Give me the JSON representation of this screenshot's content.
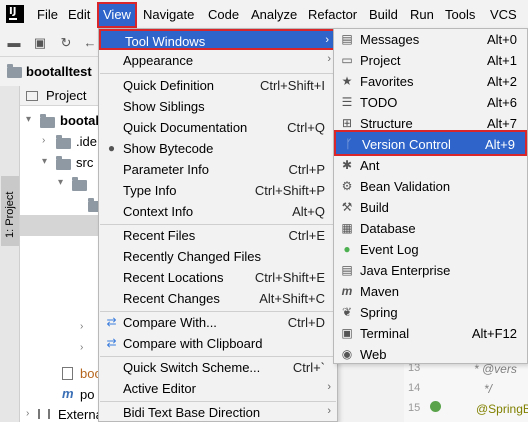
{
  "menubar": {
    "logo": "IJ",
    "items": [
      "File",
      "Edit",
      "View",
      "Navigate",
      "Code",
      "Analyze",
      "Refactor",
      "Build",
      "Run",
      "Tools",
      "VCS"
    ]
  },
  "navbar": {
    "project_name": "bootalltest"
  },
  "stripe": {
    "label": "1: Project"
  },
  "project_panel": {
    "header": "Project",
    "tree": [
      "bootal",
      ".ide",
      "src",
      "boo",
      "po",
      "Externa"
    ]
  },
  "view_menu": {
    "items": [
      {
        "label": "Tool Windows",
        "shortcut": "",
        "submenu": true,
        "active": true
      },
      {
        "label": "Appearance",
        "shortcut": "",
        "submenu": true
      },
      {
        "label": "Quick Definition",
        "shortcut": "Ctrl+Shift+I"
      },
      {
        "label": "Show Siblings",
        "shortcut": ""
      },
      {
        "label": "Quick Documentation",
        "shortcut": "Ctrl+Q"
      },
      {
        "label": "Show Bytecode",
        "shortcut": "",
        "icon": "bytecode-icon"
      },
      {
        "label": "Parameter Info",
        "shortcut": "Ctrl+P"
      },
      {
        "label": "Type Info",
        "shortcut": "Ctrl+Shift+P"
      },
      {
        "label": "Context Info",
        "shortcut": "Alt+Q"
      },
      {
        "label": "Recent Files",
        "shortcut": "Ctrl+E"
      },
      {
        "label": "Recently Changed Files",
        "shortcut": ""
      },
      {
        "label": "Recent Locations",
        "shortcut": "Ctrl+Shift+E"
      },
      {
        "label": "Recent Changes",
        "shortcut": "Alt+Shift+C"
      },
      {
        "label": "Compare With...",
        "shortcut": "Ctrl+D",
        "icon": "compare-icon"
      },
      {
        "label": "Compare with Clipboard",
        "shortcut": "",
        "icon": "compare-clipboard-icon"
      },
      {
        "label": "Quick Switch Scheme...",
        "shortcut": "Ctrl+`"
      },
      {
        "label": "Active Editor",
        "shortcut": "",
        "submenu": true
      },
      {
        "label": "Bidi Text Base Direction",
        "shortcut": "",
        "submenu": true
      }
    ]
  },
  "tool_windows_menu": {
    "items": [
      {
        "label": "Messages",
        "shortcut": "Alt+0",
        "icon": "messages-icon"
      },
      {
        "label": "Project",
        "shortcut": "Alt+1",
        "icon": "project-icon"
      },
      {
        "label": "Favorites",
        "shortcut": "Alt+2",
        "icon": "star-icon"
      },
      {
        "label": "TODO",
        "shortcut": "Alt+6",
        "icon": "todo-icon"
      },
      {
        "label": "Structure",
        "shortcut": "Alt+7",
        "icon": "structure-icon"
      },
      {
        "label": "Version Control",
        "shortcut": "Alt+9",
        "icon": "vcs-icon",
        "active": true
      },
      {
        "label": "Ant",
        "shortcut": "",
        "icon": "ant-icon"
      },
      {
        "label": "Bean Validation",
        "shortcut": "",
        "icon": "bean-validation-icon"
      },
      {
        "label": "Build",
        "shortcut": "",
        "icon": "build-icon"
      },
      {
        "label": "Database",
        "shortcut": "",
        "icon": "database-icon"
      },
      {
        "label": "Event Log",
        "shortcut": "",
        "icon": "event-log-icon"
      },
      {
        "label": "Java Enterprise",
        "shortcut": "",
        "icon": "java-enterprise-icon"
      },
      {
        "label": "Maven",
        "shortcut": "",
        "icon": "maven-icon"
      },
      {
        "label": "Spring",
        "shortcut": "",
        "icon": "spring-icon"
      },
      {
        "label": "Terminal",
        "shortcut": "Alt+F12",
        "icon": "terminal-icon"
      },
      {
        "label": "Web",
        "shortcut": "",
        "icon": "web-icon"
      }
    ]
  },
  "editor": {
    "lines": [
      {
        "num": "13",
        "code": "* @vers"
      },
      {
        "num": "14",
        "code": "*/"
      },
      {
        "num": "15",
        "code": "@SpringB"
      }
    ]
  },
  "colors": {
    "selection": "#2f65ca",
    "highlight_border": "#d9262a",
    "menu_bg": "#f2f2f2"
  }
}
